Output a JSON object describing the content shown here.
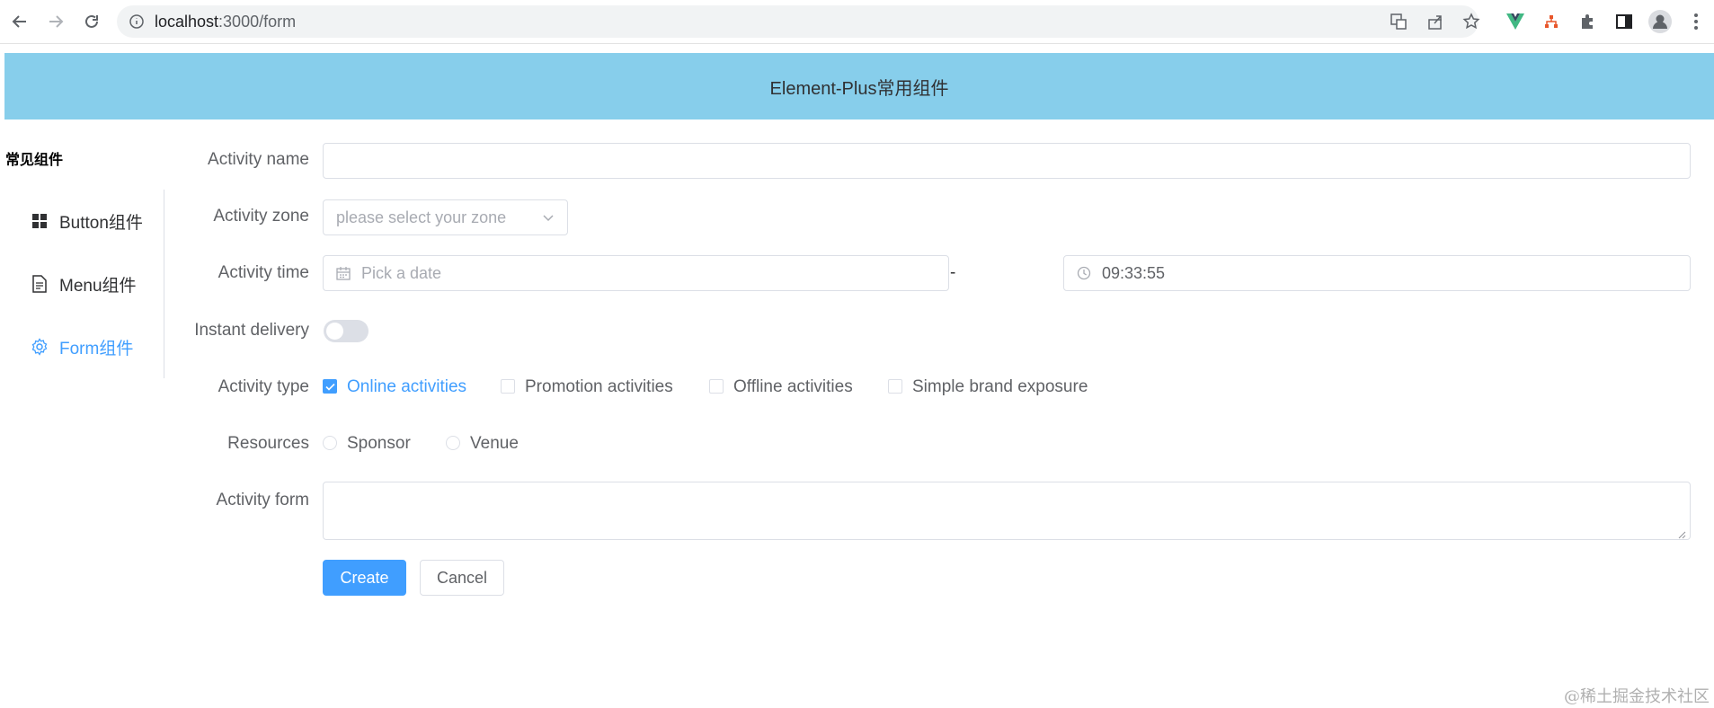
{
  "browser": {
    "url_host": "localhost",
    "url_rest": ":3000/form"
  },
  "header": {
    "title": "Element-Plus常用组件"
  },
  "sidebar": {
    "title": "常见组件",
    "items": [
      {
        "label": "Button组件",
        "icon": "grid-icon",
        "active": false
      },
      {
        "label": "Menu组件",
        "icon": "document-icon",
        "active": false
      },
      {
        "label": "Form组件",
        "icon": "gear-icon",
        "active": true
      }
    ]
  },
  "form": {
    "name": {
      "label": "Activity name",
      "value": ""
    },
    "zone": {
      "label": "Activity zone",
      "placeholder": "please select your zone"
    },
    "time": {
      "label": "Activity time",
      "date_placeholder": "Pick a date",
      "separator": "-",
      "time_value": "09:33:55"
    },
    "delivery": {
      "label": "Instant delivery",
      "on": false
    },
    "type": {
      "label": "Activity type",
      "options": [
        {
          "label": "Online activities",
          "checked": true
        },
        {
          "label": "Promotion activities",
          "checked": false
        },
        {
          "label": "Offline activities",
          "checked": false
        },
        {
          "label": "Simple brand exposure",
          "checked": false
        }
      ]
    },
    "resources": {
      "label": "Resources",
      "options": [
        "Sponsor",
        "Venue"
      ]
    },
    "desc": {
      "label": "Activity form",
      "value": ""
    },
    "buttons": {
      "create": "Create",
      "cancel": "Cancel"
    }
  },
  "colors": {
    "primary": "#409eff",
    "header_bg": "#87ceeb",
    "border": "#dcdfe6"
  },
  "watermark": "@稀土掘金技术社区"
}
